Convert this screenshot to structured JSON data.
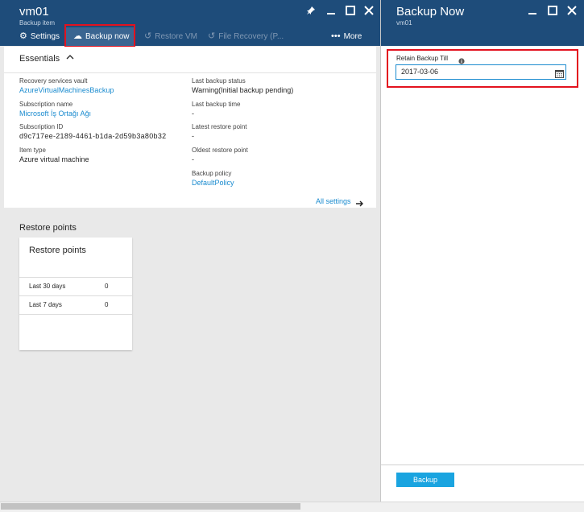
{
  "left_blade": {
    "title": "vm01",
    "subtitle": "Backup item",
    "commands": {
      "settings": "Settings",
      "backup_now": "Backup now",
      "restore_vm": "Restore VM",
      "file_recovery": "File Recovery (P...",
      "more": "More"
    },
    "essentials": {
      "title": "Essentials",
      "left": [
        {
          "label": "Recovery services vault",
          "value": "AzureVirtualMachinesBackup"
        },
        {
          "label": "Subscription name",
          "value": "Microsoft İş Ortağı Ağı"
        },
        {
          "label": "Subscription ID",
          "value": "d9c717ee-2189-4461-b1da-2d59b3a80b32"
        },
        {
          "label": "Item type",
          "value": "Azure virtual machine"
        }
      ],
      "right": [
        {
          "label": "Last backup status",
          "value": "Warning(Initial backup pending)"
        },
        {
          "label": "Last backup time",
          "value": "-"
        },
        {
          "label": "Latest restore point",
          "value": "-"
        },
        {
          "label": "Oldest restore point",
          "value": "-"
        },
        {
          "label": "Backup policy",
          "value": "DefaultPolicy"
        }
      ],
      "all_settings": "All settings"
    },
    "restore_points": {
      "section_title": "Restore points",
      "card_title": "Restore points",
      "rows": [
        {
          "label": "Last 30 days",
          "value": "0"
        },
        {
          "label": "Last 7 days",
          "value": "0"
        }
      ]
    }
  },
  "right_blade": {
    "title": "Backup Now",
    "subtitle": "vm01",
    "retain_label": "Retain Backup Till",
    "retain_value": "2017-03-06",
    "backup_button": "Backup"
  },
  "colors": {
    "header": "#1e4c7a",
    "accent": "#1a8bcf",
    "highlight": "#e3121e",
    "button": "#1aa4e0"
  },
  "icons": [
    "pin-icon",
    "minimize-icon",
    "maximize-icon",
    "close-icon",
    "gear-icon",
    "backup-icon",
    "restore-icon",
    "file-recovery-icon",
    "more-icon",
    "chevron-up-icon",
    "arrow-right-icon",
    "info-icon",
    "calendar-icon"
  ]
}
